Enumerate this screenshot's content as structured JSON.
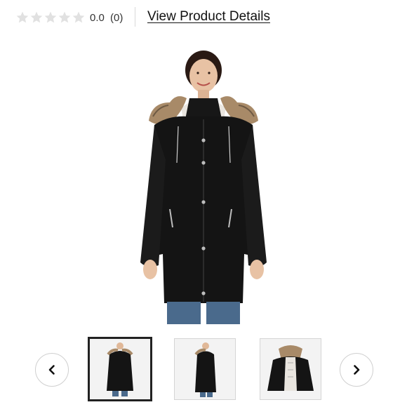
{
  "rating": {
    "value": "0.0",
    "count": "(0)",
    "stars_filled": 0,
    "stars_total": 5,
    "star_color": "#e1e1e1"
  },
  "header": {
    "details_link": "View Product Details"
  },
  "product": {
    "main_image": "woman-black-parka-fur-hood-photo",
    "coat_color": "#141414",
    "fur_color": "#a88a68"
  },
  "carousel": {
    "prev_icon": "chevron-left-icon",
    "next_icon": "chevron-right-icon",
    "thumbnails": [
      {
        "name": "front-view-thumbnail",
        "active": true
      },
      {
        "name": "side-view-thumbnail",
        "active": false
      },
      {
        "name": "flat-open-jacket-thumbnail",
        "active": false
      }
    ]
  }
}
